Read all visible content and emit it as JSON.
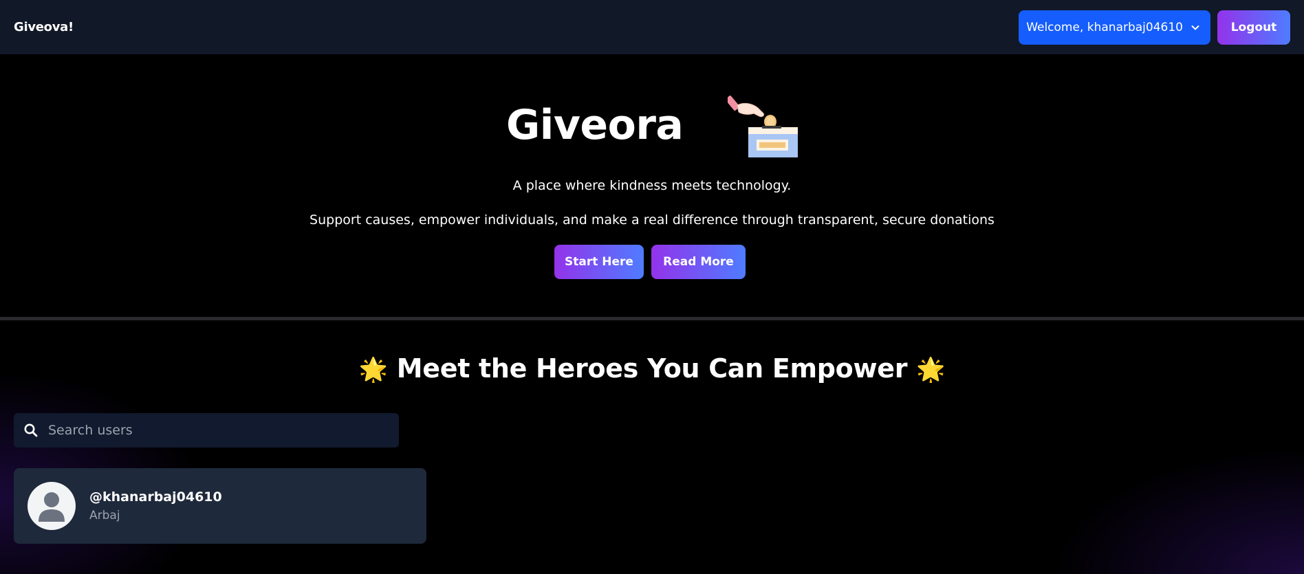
{
  "navbar": {
    "brand": "Giveova!",
    "welcome_label": "Welcome, khanarbaj04610",
    "logout_label": "Logout"
  },
  "hero": {
    "title": "Giveora",
    "tagline": "A place where kindness meets technology.",
    "subline": "Support causes, empower individuals, and make a real difference through transparent, secure donations",
    "start_label": "Start Here",
    "read_label": "Read More",
    "illustration_icon": "donation-box-icon"
  },
  "heroes": {
    "heading": "Meet the Heroes You Can Empower",
    "star_icon": "🌟"
  },
  "search": {
    "placeholder": "Search users",
    "value": ""
  },
  "users": [
    {
      "handle": "@khanarbaj04610",
      "name": "Arbaj"
    }
  ],
  "colors": {
    "navbar_bg": "#111827",
    "welcome_btn": "#155dfc",
    "gradient_start": "#9333ea",
    "gradient_end": "#4f7cff",
    "card_bg": "#1e293b"
  }
}
